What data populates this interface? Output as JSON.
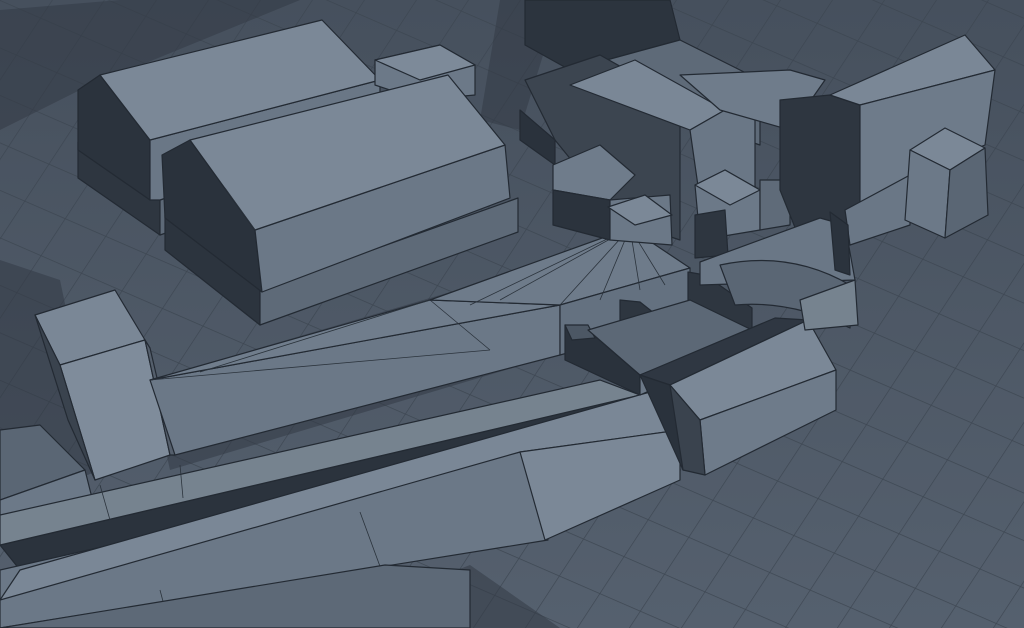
{
  "scene": {
    "kind": "3d-viewport-render",
    "description_visible_text": "",
    "colors": {
      "background": "#4d5866",
      "grid_line": "#3a434e",
      "roof_light": "#7a8796",
      "wall_light": "#6f7c8b",
      "wall_mid": "#5a6674",
      "wall_dark": "#2c343e",
      "shadow": "#3b444f",
      "edge": "#232a33"
    },
    "objects": [
      "building-block-large-left-back",
      "building-block-large-left-front",
      "small-shed-left",
      "tall-tower-left",
      "long-terrace-front",
      "long-low-wall-middle",
      "pyramid-roof-courtyard",
      "walled-enclosure-center",
      "gable-house-center-right",
      "cluster-buildings-back-right",
      "tall-gable-right",
      "small-cube-far-right",
      "curved-wall-connector"
    ]
  }
}
